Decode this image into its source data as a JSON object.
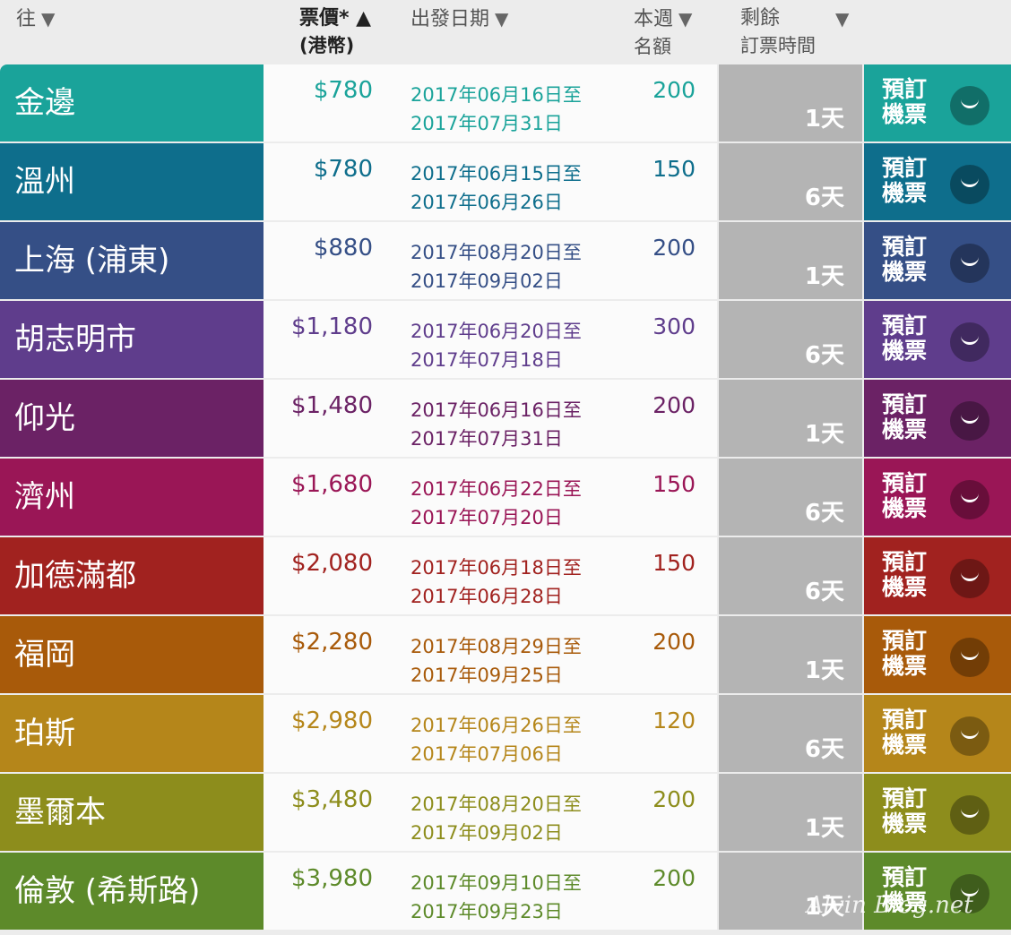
{
  "header": {
    "destination": "往",
    "price_line1": "票價* ▲",
    "price_line2": "(港幣)",
    "date": "出發日期",
    "quota_line1": "本週",
    "quota_line2": "名額",
    "remain_line1": "剩餘",
    "remain_line2": "訂票時間",
    "sort_down": "▼"
  },
  "watermark": "Alvin Blog.net",
  "rows": [
    {
      "dest": "金邊",
      "price": "$780",
      "start": "2017年06月16日至",
      "end": "2017年07月31日",
      "quota": "200",
      "remain": "1天",
      "book": [
        "預訂",
        "機票"
      ],
      "color": "#1aa39a"
    },
    {
      "dest": "溫州",
      "price": "$780",
      "start": "2017年06月15日至",
      "end": "2017年06月26日",
      "quota": "150",
      "remain": "6天",
      "book": [
        "預訂",
        "機票"
      ],
      "color": "#0e6e8c"
    },
    {
      "dest": "上海 (浦東)",
      "price": "$880",
      "start": "2017年08月20日至",
      "end": "2017年09月02日",
      "quota": "200",
      "remain": "1天",
      "book": [
        "預訂",
        "機票"
      ],
      "color": "#354f86"
    },
    {
      "dest": "胡志明市",
      "price": "$1,180",
      "start": "2017年06月20日至",
      "end": "2017年07月18日",
      "quota": "300",
      "remain": "6天",
      "book": [
        "預訂",
        "機票"
      ],
      "color": "#5f3d8c"
    },
    {
      "dest": "仰光",
      "price": "$1,480",
      "start": "2017年06月16日至",
      "end": "2017年07月31日",
      "quota": "200",
      "remain": "1天",
      "book": [
        "預訂",
        "機票"
      ],
      "color": "#6b2265"
    },
    {
      "dest": "濟州",
      "price": "$1,680",
      "start": "2017年06月22日至",
      "end": "2017年07月20日",
      "quota": "150",
      "remain": "6天",
      "book": [
        "預訂",
        "機票"
      ],
      "color": "#9a1656"
    },
    {
      "dest": "加德滿都",
      "price": "$2,080",
      "start": "2017年06月18日至",
      "end": "2017年06月28日",
      "quota": "150",
      "remain": "6天",
      "book": [
        "預訂",
        "機票"
      ],
      "color": "#a1221f"
    },
    {
      "dest": "福岡",
      "price": "$2,280",
      "start": "2017年08月29日至",
      "end": "2017年09月25日",
      "quota": "200",
      "remain": "1天",
      "book": [
        "預訂",
        "機票"
      ],
      "color": "#a85a0a"
    },
    {
      "dest": "珀斯",
      "price": "$2,980",
      "start": "2017年06月26日至",
      "end": "2017年07月06日",
      "quota": "120",
      "remain": "6天",
      "book": [
        "預訂",
        "機票"
      ],
      "color": "#b5861a"
    },
    {
      "dest": "墨爾本",
      "price": "$3,480",
      "start": "2017年08月20日至",
      "end": "2017年09月02日",
      "quota": "200",
      "remain": "1天",
      "book": [
        "預訂",
        "機票"
      ],
      "color": "#8d8d1c"
    },
    {
      "dest": "倫敦 (希斯路)",
      "price": "$3,980",
      "start": "2017年09月10日至",
      "end": "2017年09月23日",
      "quota": "200",
      "remain": "1天",
      "book": [
        "預訂",
        "機票"
      ],
      "color": "#5d8a2a"
    }
  ]
}
